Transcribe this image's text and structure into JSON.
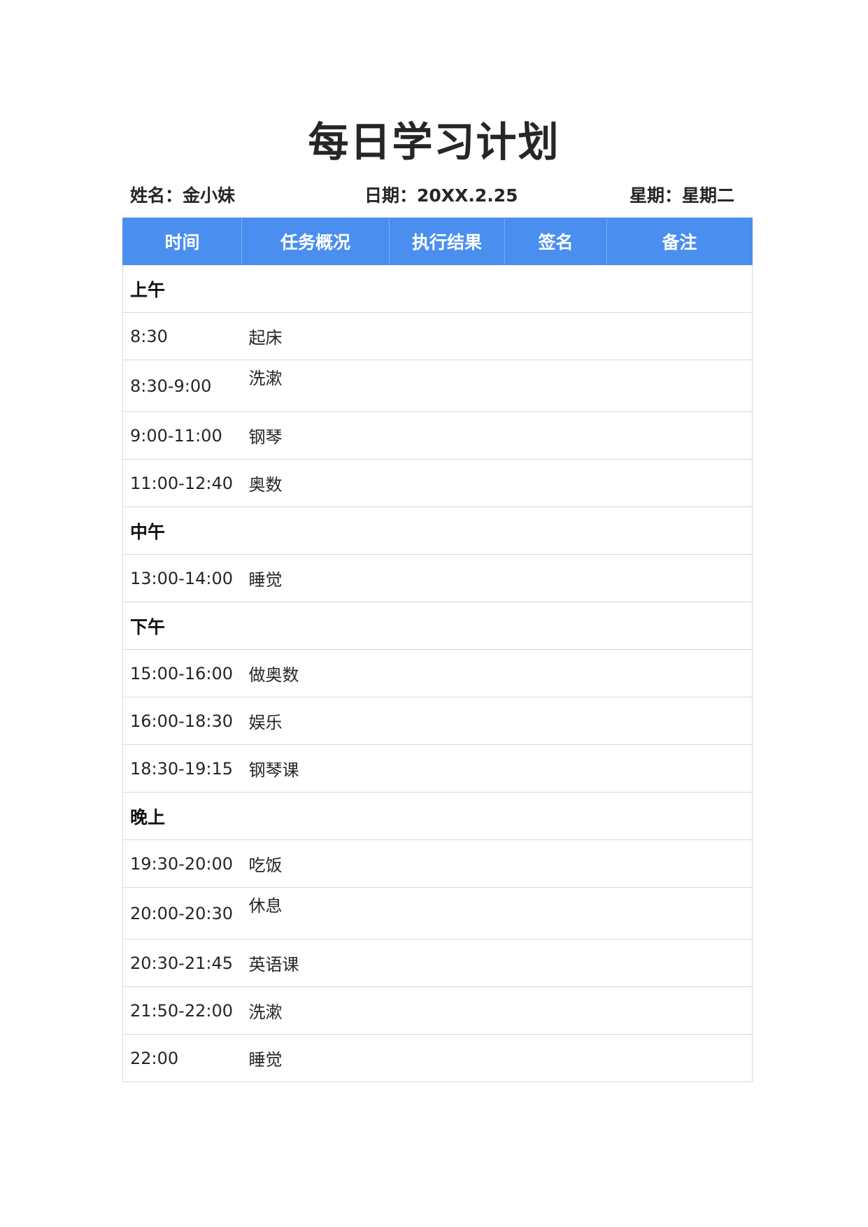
{
  "title": "每日学习计划",
  "info": {
    "name": "姓名：金小妹",
    "date": "日期：20XX.2.25",
    "weekday": "星期：星期二"
  },
  "colors": {
    "header_bg": "#4a8ff0",
    "header_text": "#ffffff",
    "grid_line": "#d9d9d9"
  },
  "table": {
    "headers": [
      "时间",
      "任务概况",
      "执行结果",
      "签名",
      "备注"
    ],
    "sections": [
      {
        "label": "上午",
        "rows": [
          {
            "time": "8:30",
            "task": "起床",
            "result": "",
            "signature": "",
            "remark": ""
          },
          {
            "time": "8:30-9:00",
            "task": "洗漱",
            "result": "",
            "signature": "",
            "remark": ""
          },
          {
            "time": "9:00-11:00",
            "task": "钢琴",
            "result": "",
            "signature": "",
            "remark": ""
          },
          {
            "time": "11:00-12:40",
            "task": "奥数",
            "result": "",
            "signature": "",
            "remark": ""
          }
        ]
      },
      {
        "label": "中午",
        "rows": [
          {
            "time": "13:00-14:00",
            "task": "睡觉",
            "result": "",
            "signature": "",
            "remark": ""
          }
        ]
      },
      {
        "label": "下午",
        "rows": [
          {
            "time": "15:00-16:00",
            "task": "做奥数",
            "result": "",
            "signature": "",
            "remark": ""
          },
          {
            "time": "16:00-18:30",
            "task": "娱乐",
            "result": "",
            "signature": "",
            "remark": ""
          },
          {
            "time": "18:30-19:15",
            "task": "钢琴课",
            "result": "",
            "signature": "",
            "remark": ""
          }
        ]
      },
      {
        "label": "晚上",
        "rows": [
          {
            "time": "19:30-20:00",
            "task": "吃饭",
            "result": "",
            "signature": "",
            "remark": ""
          },
          {
            "time": "20:00-20:30",
            "task": "休息",
            "result": "",
            "signature": "",
            "remark": ""
          },
          {
            "time": "20:30-21:45",
            "task": "英语课",
            "result": "",
            "signature": "",
            "remark": ""
          },
          {
            "time": "21:50-22:00",
            "task": "洗漱",
            "result": "",
            "signature": "",
            "remark": ""
          },
          {
            "time": "22:00",
            "task": "睡觉",
            "result": "",
            "signature": "",
            "remark": ""
          }
        ]
      }
    ]
  }
}
